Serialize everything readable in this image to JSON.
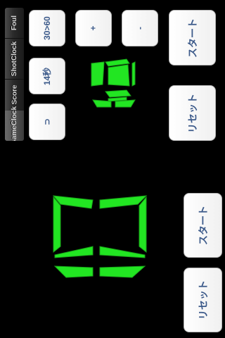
{
  "tabs": [
    {
      "label": "Foul",
      "active": false
    },
    {
      "label": "ShotClock",
      "active": false
    },
    {
      "label": "Score",
      "active": false
    },
    {
      "label": "GameClock",
      "active": true
    }
  ],
  "shot_clock_buttons": {
    "reset_30_60": "30>60",
    "set_14s": "14秒",
    "extra": "⊃",
    "plus": "+",
    "minus": "-",
    "start": "スタート",
    "reset": "リセット"
  },
  "game_clock_buttons": {
    "start": "スタート",
    "reset": "リセット"
  },
  "display_color": "#22e622"
}
